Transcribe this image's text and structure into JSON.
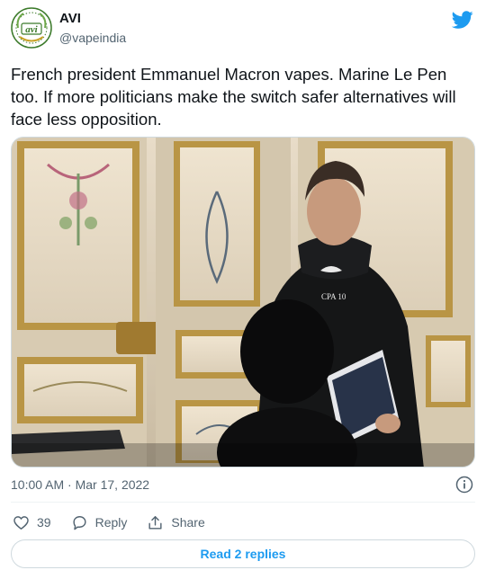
{
  "author": {
    "name": "AVI",
    "handle": "@vapeindia",
    "avatar_icon": "avi-logo-icon",
    "logo_text": "avi"
  },
  "tweet": {
    "text": "French president Emmanuel Macron vapes. Marine Le Pen too. If more politicians make the switch safer alternatives will face less opposition.",
    "image_caption_text": "CPA 10",
    "timestamp": "10:00 AM · Mar 17, 2022"
  },
  "actions": {
    "like_count": "39",
    "reply_label": "Reply",
    "share_label": "Share",
    "read_replies_label": "Read 2 replies"
  },
  "icons": {
    "brand": "twitter-bird-icon",
    "info": "info-icon",
    "like": "heart-icon",
    "reply": "reply-bubble-icon",
    "share": "share-icon"
  },
  "colors": {
    "brand": "#1d9bf0",
    "text": "#0f1419",
    "muted": "#536471",
    "logo_green": "#3b7a2a"
  }
}
